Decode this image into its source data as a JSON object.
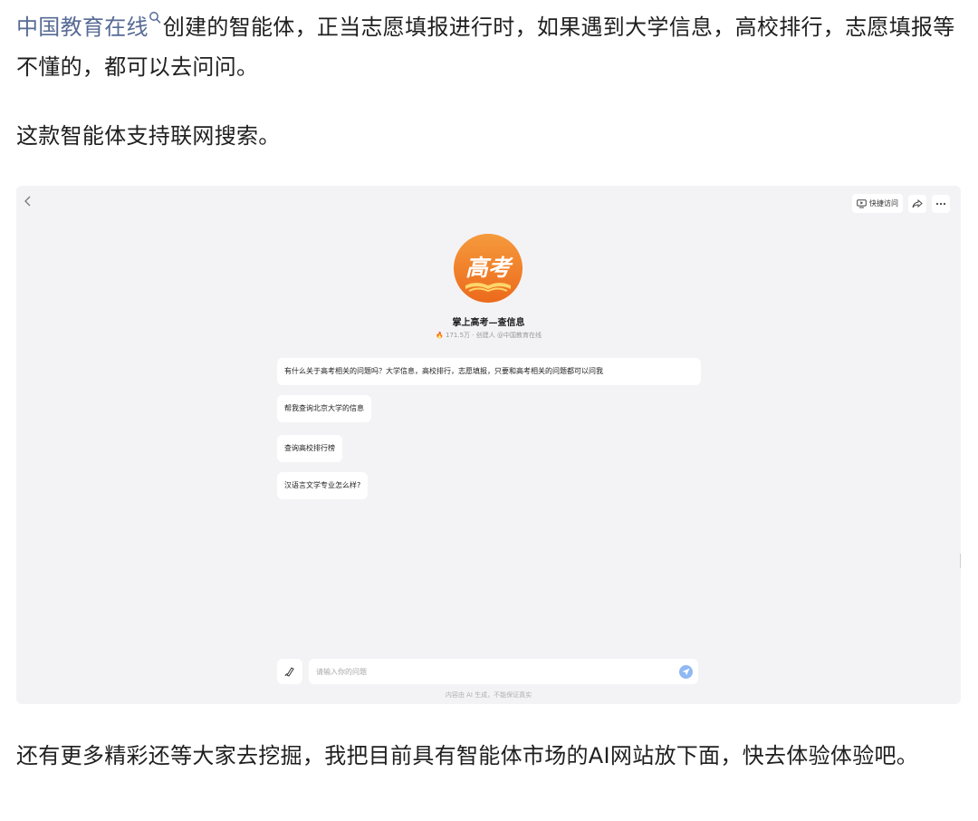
{
  "article": {
    "p1_link": "中国教育在线",
    "p1_rest": "创建的智能体，正当志愿填报进行时，如果遇到大学信息，高校排行，志愿填报等不懂的，都可以去问问。",
    "p2": "这款智能体支持联网搜索。",
    "p3": "还有更多精彩还等大家去挖掘，我把目前具有智能体市场的AI网站放下面，快去体验体验吧。"
  },
  "app": {
    "quick_access_label": "快捷访问",
    "logo_text": "高考",
    "bot_name": "掌上高考—查信息",
    "meta_users": "171.5万",
    "meta_role": "创建人",
    "meta_creator": "@中国教育在线",
    "intro_message": "有什么关于高考相关的问题吗？大学信息，高校排行，志愿填报，只要和高考相关的问题都可以问我",
    "suggestions": [
      "帮我查询北京大学的信息",
      "查询高校排行榜",
      "汉语言文学专业怎么样?"
    ],
    "input_placeholder": "请输入你的问题",
    "disclaimer": "内容由 AI 生成，不能保证真实"
  },
  "colors": {
    "link": "#576b95",
    "logo_orange": "#f07a28",
    "send_blue": "#8fb8f4"
  }
}
